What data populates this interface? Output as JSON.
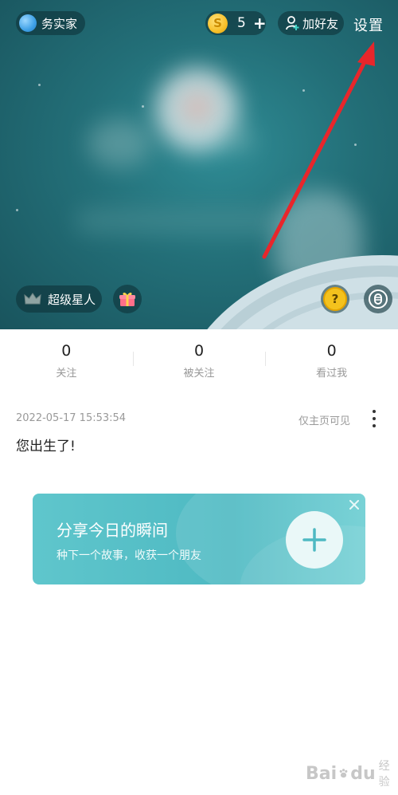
{
  "header": {
    "username": "务实家",
    "coins": "5",
    "coin_symbol": "S",
    "coin_plus": "+",
    "add_friend_label": "加好友",
    "settings_label": "设置",
    "vip_label": "超级星人",
    "help_symbol": "?"
  },
  "stats": [
    {
      "value": "0",
      "label": "关注"
    },
    {
      "value": "0",
      "label": "被关注"
    },
    {
      "value": "0",
      "label": "看过我"
    }
  ],
  "post": {
    "timestamp": "2022-05-17 15:53:54",
    "visibility": "仅主页可见",
    "text": "您出生了!"
  },
  "share_card": {
    "title": "分享今日的瞬间",
    "subtitle": "种下一个故事，收获一个朋友"
  },
  "watermark": {
    "brand": "Bai",
    "brand2": "du",
    "suffix": "经验"
  },
  "colors": {
    "hero_bg": "#236f78",
    "share_card_bg": "#52bcc4",
    "annotation_arrow": "#e8262b"
  },
  "icons": {
    "globe": "globe-icon",
    "coin": "coin-icon",
    "add_friend": "add-friend-icon",
    "crown": "crown-icon",
    "gift": "gift-icon",
    "help": "help-icon",
    "voice": "voice-icon",
    "more": "more-vertical-icon",
    "plus": "plus-icon",
    "close": "close-icon"
  }
}
